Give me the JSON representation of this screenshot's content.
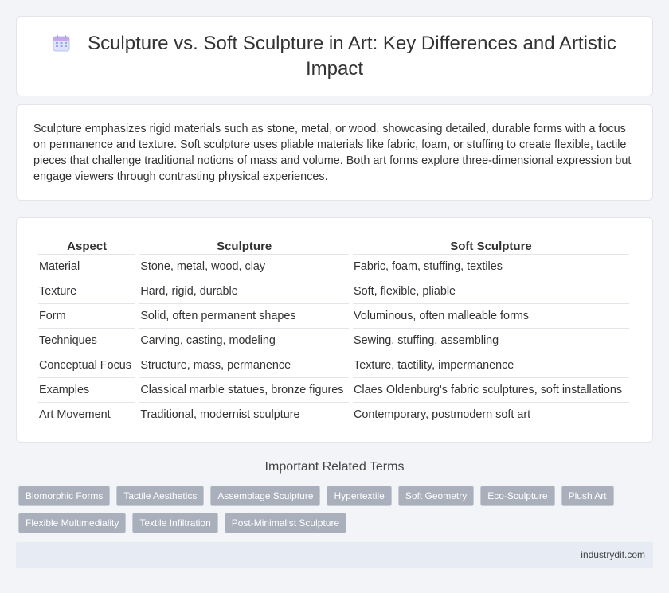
{
  "header": {
    "title": "Sculpture vs. Soft Sculpture in Art: Key Differences and Artistic Impact",
    "icon": "calendar-icon"
  },
  "intro": {
    "text": "Sculpture emphasizes rigid materials such as stone, metal, or wood, showcasing detailed, durable forms with a focus on permanence and texture. Soft sculpture uses pliable materials like fabric, foam, or stuffing to create flexible, tactile pieces that challenge traditional notions of mass and volume. Both art forms explore three-dimensional expression but engage viewers through contrasting physical experiences."
  },
  "table": {
    "headers": [
      "Aspect",
      "Sculpture",
      "Soft Sculpture"
    ],
    "rows": [
      [
        "Material",
        "Stone, metal, wood, clay",
        "Fabric, foam, stuffing, textiles"
      ],
      [
        "Texture",
        "Hard, rigid, durable",
        "Soft, flexible, pliable"
      ],
      [
        "Form",
        "Solid, often permanent shapes",
        "Voluminous, often malleable forms"
      ],
      [
        "Techniques",
        "Carving, casting, modeling",
        "Sewing, stuffing, assembling"
      ],
      [
        "Conceptual Focus",
        "Structure, mass, permanence",
        "Texture, tactility, impermanence"
      ],
      [
        "Examples",
        "Classical marble statues, bronze figures",
        "Claes Oldenburg's fabric sculptures, soft installations"
      ],
      [
        "Art Movement",
        "Traditional, modernist sculpture",
        "Contemporary, postmodern soft art"
      ]
    ]
  },
  "related": {
    "title": "Important Related Terms",
    "tags": [
      "Biomorphic Forms",
      "Tactile Aesthetics",
      "Assemblage Sculpture",
      "Hypertextile",
      "Soft Geometry",
      "Eco-Sculpture",
      "Plush Art",
      "Flexible Multimediality",
      "Textile Infiltration",
      "Post-Minimalist Sculpture"
    ]
  },
  "footer": {
    "site": "industrydif.com"
  }
}
